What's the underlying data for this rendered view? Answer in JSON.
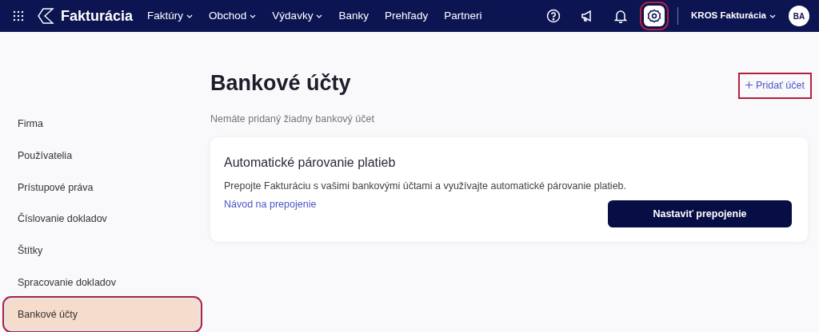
{
  "navbar": {
    "brand": "Fakturácia",
    "menu": [
      {
        "label": "Faktúry",
        "dropdown": true
      },
      {
        "label": "Obchod",
        "dropdown": true
      },
      {
        "label": "Výdavky",
        "dropdown": true
      },
      {
        "label": "Banky",
        "dropdown": false
      },
      {
        "label": "Prehľady",
        "dropdown": false
      },
      {
        "label": "Partneri",
        "dropdown": false
      }
    ],
    "icons": [
      {
        "kind": "help",
        "selected": false,
        "highlighted": false
      },
      {
        "kind": "megaphone",
        "selected": false,
        "highlighted": false
      },
      {
        "kind": "bell",
        "selected": false,
        "highlighted": false
      },
      {
        "kind": "settings",
        "selected": true,
        "highlighted": true
      }
    ],
    "account": "KROS Fakturácia",
    "avatar": "BA"
  },
  "sidebar": {
    "items": [
      {
        "label": "Firma",
        "selected": false,
        "highlighted": false
      },
      {
        "label": "Používatelia",
        "selected": false,
        "highlighted": false
      },
      {
        "label": "Prístupové práva",
        "selected": false,
        "highlighted": false
      },
      {
        "label": "Číslovanie dokladov",
        "selected": false,
        "highlighted": false
      },
      {
        "label": "Štítky",
        "selected": false,
        "highlighted": false
      },
      {
        "label": "Spracovanie dokladov",
        "selected": false,
        "highlighted": false
      },
      {
        "label": "Bankové účty",
        "selected": true,
        "highlighted": true
      }
    ]
  },
  "page": {
    "title": "Bankové účty",
    "add_button": {
      "label": "Pridať účet",
      "highlighted": true
    },
    "empty_message": "Nemáte pridaný žiadny bankový účet",
    "card": {
      "title": "Automatické párovanie platieb",
      "text": "Prepojte Fakturáciu s vašimi bankovými účtami a využívajte automatické párovanie platieb.",
      "link": "Návod na prepojenie",
      "button": "Nastaviť prepojenie"
    }
  }
}
